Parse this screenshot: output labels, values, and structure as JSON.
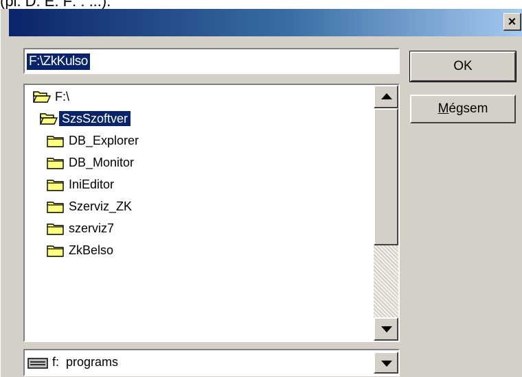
{
  "background_text": "(pl. D: E: F: : ...).",
  "dialog": {
    "close_label": "×"
  },
  "path_input": {
    "value": "F:\\ZkKulso"
  },
  "buttons": {
    "ok": "OK",
    "cancel_mnemonic": "M",
    "cancel_rest": "égsem"
  },
  "folders": [
    {
      "label": "F:\\",
      "icon": "open-folder-icon",
      "indent": 0,
      "selected": false
    },
    {
      "label": "SzsSzoftver",
      "icon": "open-folder-icon",
      "indent": 1,
      "selected": true
    },
    {
      "label": "DB_Explorer",
      "icon": "folder-icon",
      "indent": 2,
      "selected": false
    },
    {
      "label": "DB_Monitor",
      "icon": "folder-icon",
      "indent": 2,
      "selected": false
    },
    {
      "label": "IniEditor",
      "icon": "folder-icon",
      "indent": 2,
      "selected": false
    },
    {
      "label": "Szerviz_ZK",
      "icon": "folder-icon",
      "indent": 2,
      "selected": false
    },
    {
      "label": "szerviz7",
      "icon": "folder-icon",
      "indent": 2,
      "selected": false
    },
    {
      "label": "ZkBelso",
      "icon": "folder-icon",
      "indent": 2,
      "selected": false
    }
  ],
  "drive": {
    "label": "f:  programs",
    "icon": "drive-icon"
  },
  "colors": {
    "selection": "#0a246a",
    "face": "#d4d0c8",
    "folder_yellow": "#ffff80"
  }
}
